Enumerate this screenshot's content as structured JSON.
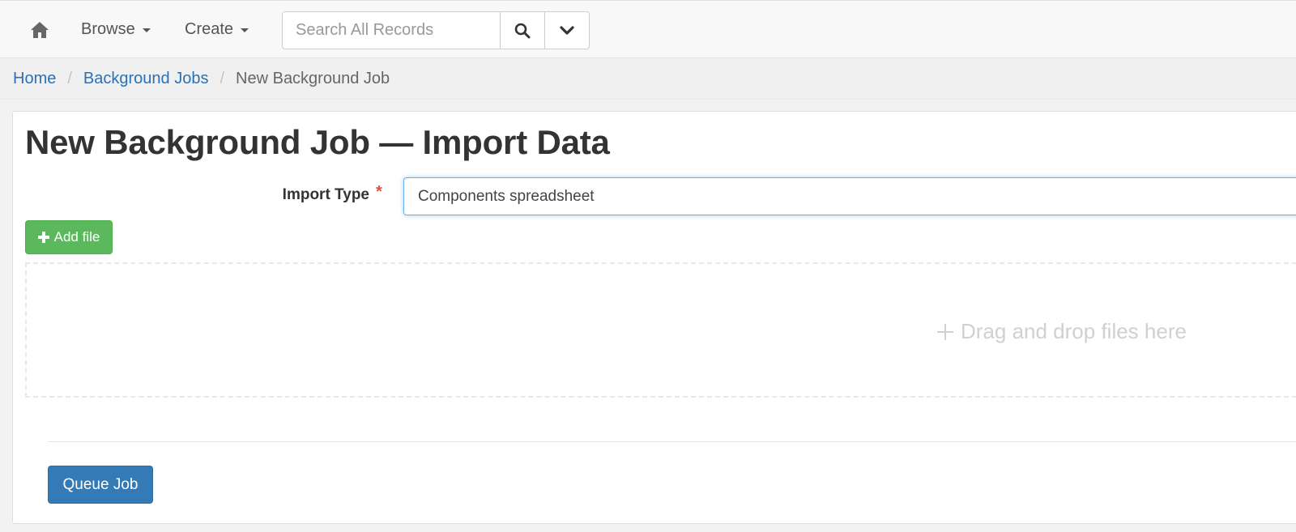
{
  "nav": {
    "browse_label": "Browse",
    "create_label": "Create",
    "search_placeholder": "Search All Records"
  },
  "breadcrumb": {
    "home": "Home",
    "background_jobs": "Background Jobs",
    "current": "New Background Job",
    "separator": "/"
  },
  "page": {
    "title": "New Background Job — Import Data"
  },
  "form": {
    "import_type_label": "Import Type",
    "required_marker": "*",
    "import_type_value": "Components spreadsheet",
    "add_file_label": "Add file",
    "dropzone_text": "Drag and drop files here",
    "submit_label": "Queue Job"
  },
  "colors": {
    "link": "#2a72b5",
    "success": "#5cb85c",
    "primary": "#337ab7",
    "required": "#e74c3c"
  },
  "icons": {
    "home": "home-icon",
    "search": "search-icon",
    "chevron": "chevron-down-icon",
    "plus": "plus-icon"
  }
}
